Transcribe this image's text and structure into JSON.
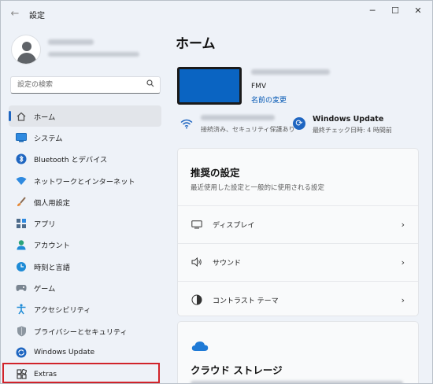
{
  "window": {
    "title": "設定",
    "back_icon": "arrow-left-icon",
    "controls": {
      "minimize": "─",
      "maximize": "☐",
      "close": "✕"
    }
  },
  "search": {
    "placeholder": "設定の検索",
    "value": ""
  },
  "nav": {
    "items": [
      {
        "label": "ホーム",
        "icon": "home-icon",
        "active": true
      },
      {
        "label": "システム",
        "icon": "system-icon"
      },
      {
        "label": "Bluetooth とデバイス",
        "icon": "bluetooth-icon"
      },
      {
        "label": "ネットワークとインターネット",
        "icon": "network-icon"
      },
      {
        "label": "個人用設定",
        "icon": "brush-icon"
      },
      {
        "label": "アプリ",
        "icon": "apps-icon"
      },
      {
        "label": "アカウント",
        "icon": "account-icon"
      },
      {
        "label": "時刻と言語",
        "icon": "time-language-icon"
      },
      {
        "label": "ゲーム",
        "icon": "gaming-icon"
      },
      {
        "label": "アクセシビリティ",
        "icon": "accessibility-icon"
      },
      {
        "label": "プライバシーとセキュリティ",
        "icon": "shield-icon"
      },
      {
        "label": "Windows Update",
        "icon": "update-icon"
      },
      {
        "label": "Extras",
        "icon": "extras-icon",
        "highlighted": true
      }
    ]
  },
  "main": {
    "title": "ホーム",
    "device": {
      "model": "FMV",
      "rename_link": "名前の変更"
    },
    "network": {
      "status": "接続済み、セキュリティ保護あり"
    },
    "windows_update": {
      "title": "Windows Update",
      "status": "最終チェック日時: 4 時間前"
    },
    "recommended": {
      "title": "推奨の設定",
      "subtitle": "最近使用した設定と一般的に使用される設定",
      "rows": [
        {
          "label": "ディスプレイ",
          "icon": "monitor-icon"
        },
        {
          "label": "サウンド",
          "icon": "speaker-icon"
        },
        {
          "label": "コントラスト テーマ",
          "icon": "contrast-icon"
        }
      ]
    },
    "cloud": {
      "title": "クラウド ストレージ",
      "icon": "cloud-icon"
    }
  },
  "colors": {
    "accent": "#1f66c1",
    "highlight_border": "#d1232a",
    "device_screen": "#0a64c2"
  }
}
